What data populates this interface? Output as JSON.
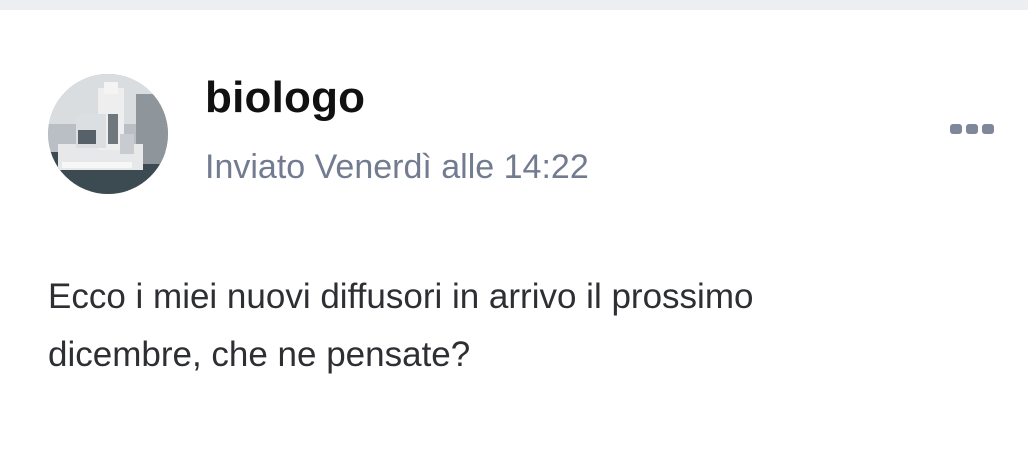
{
  "post": {
    "author": "biologo",
    "meta": "Inviato Venerdì alle 14:22",
    "body_line1": "Ecco i miei nuovi diffusori in arrivo il prossimo",
    "body_line2": "dicembre, che ne pensate?"
  },
  "icons": {
    "avatar": "avatar-microscope-photo",
    "more": "more-options-icon"
  },
  "colors": {
    "meta_text": "#727b8f",
    "author_text": "#111111",
    "body_text": "#2d2f33",
    "top_strip": "#eceef2"
  }
}
